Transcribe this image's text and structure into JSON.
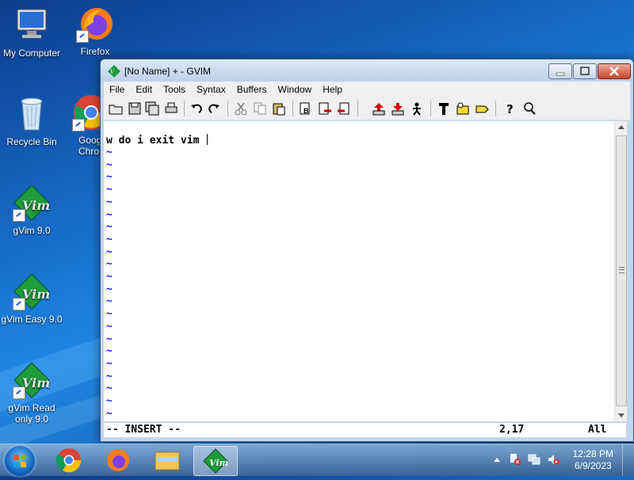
{
  "desktop": {
    "icons": [
      {
        "label": "My Computer",
        "icon": "computer-icon"
      },
      {
        "label": "Firefox",
        "icon": "firefox-icon"
      },
      {
        "label": "Recycle Bin",
        "icon": "recycle-bin-icon"
      },
      {
        "label": "Goog Chro",
        "icon": "chrome-icon"
      },
      {
        "label": "gVim 9.0",
        "icon": "gvim-icon"
      },
      {
        "label": "gVim Easy 9.0",
        "icon": "gvim-icon"
      },
      {
        "label": "gVim Read only 9.0",
        "icon": "gvim-icon"
      }
    ]
  },
  "window": {
    "title": "[No Name] + - GVIM",
    "menu": [
      "File",
      "Edit",
      "Tools",
      "Syntax",
      "Buffers",
      "Window",
      "Help"
    ],
    "toolbar_icons": [
      "open-icon",
      "save-icon",
      "save-all-icon",
      "print-icon",
      "undo-icon",
      "redo-icon",
      "cut-icon",
      "copy-icon",
      "paste-icon",
      "replace-icon",
      "find-next-icon",
      "find-prev-icon",
      "load-session-icon",
      "save-session-icon",
      "run-script-icon",
      "make-icon",
      "run-ctags-icon",
      "tag-jump-icon",
      "help-icon",
      "find-help-icon"
    ],
    "editor": {
      "line1": "w do i exit vim ",
      "tilde": "~"
    },
    "status": {
      "mode": "-- INSERT --",
      "position": "2,17",
      "scroll": "All"
    }
  },
  "taskbar": {
    "time": "12:28 PM",
    "date": "6/9/2023",
    "pinned": [
      "chrome-icon",
      "firefox-icon",
      "explorer-icon",
      "gvim-icon"
    ]
  },
  "colors": {
    "tilde": "#1a1aff",
    "desktop": "#1e6fd0"
  }
}
